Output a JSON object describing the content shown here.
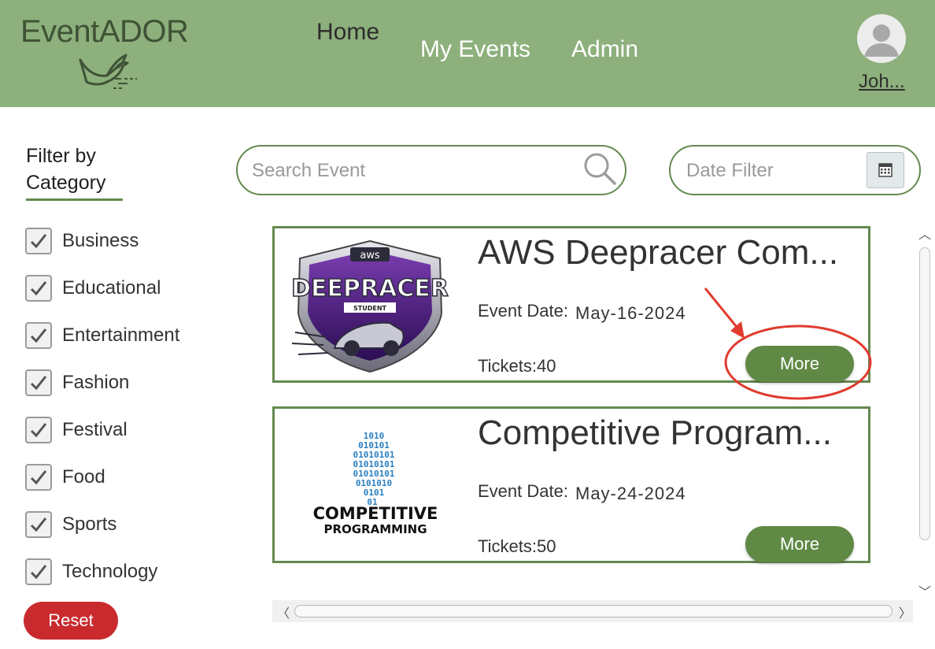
{
  "app": {
    "brand": "EventADOR",
    "nav": {
      "home": "Home",
      "my_events": "My Events",
      "admin": "Admin"
    },
    "user": {
      "name": "Joh..."
    }
  },
  "colors": {
    "header_bg": "#8db07c",
    "accent": "#64894f",
    "button": "#5f8945",
    "reset": "#c82a2e",
    "annotation": "#e03c2f"
  },
  "sidebar": {
    "title_line1": "Filter by",
    "title_line2": "Category",
    "categories": [
      {
        "label": "Business",
        "checked": true
      },
      {
        "label": "Educational",
        "checked": true
      },
      {
        "label": "Entertainment",
        "checked": true
      },
      {
        "label": "Fashion",
        "checked": true
      },
      {
        "label": "Festival",
        "checked": true
      },
      {
        "label": "Food",
        "checked": true
      },
      {
        "label": "Sports",
        "checked": true
      },
      {
        "label": "Technology",
        "checked": true
      }
    ],
    "reset_label": "Reset"
  },
  "search": {
    "placeholder": "Search Event",
    "icon": "search-icon"
  },
  "date_filter": {
    "placeholder": "Date Filter",
    "icon": "calendar-icon"
  },
  "events": [
    {
      "title": "AWS Deepracer Com...",
      "date_label": "Event Date:",
      "date": "May-16-2024",
      "tickets_label": "Tickets:",
      "tickets": "40",
      "more_label": "More",
      "logo": {
        "aws_text": "aws",
        "main_text": "DEEPRACER",
        "sub_text": "STUDENT"
      }
    },
    {
      "title": "Competitive Program...",
      "date_label": "Event Date:",
      "date": "May-24-2024",
      "tickets_label": "Tickets:",
      "tickets": "50",
      "more_label": "More",
      "logo": {
        "line1": "COMPETITIVE",
        "line2": "PROGRAMMING"
      }
    }
  ]
}
